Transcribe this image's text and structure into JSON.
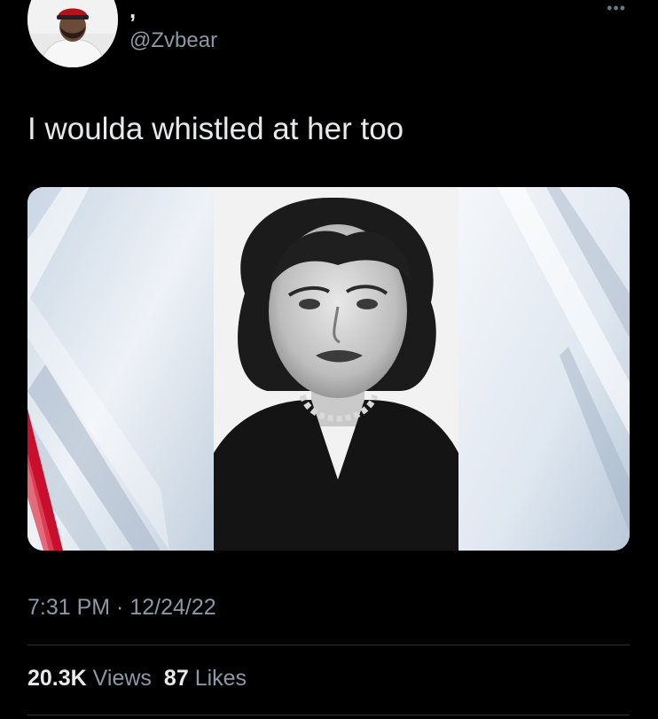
{
  "tweet": {
    "author": {
      "display_name": ",",
      "handle": "@Zvbear"
    },
    "more_icon": "more-horizontal-icon",
    "text": "I woulda whistled at her too",
    "timestamp": "7:31 PM · 12/24/22",
    "stats": {
      "views_count": "20.3K",
      "views_label": "Views",
      "likes_count": "87",
      "likes_label": "Likes"
    }
  },
  "colors": {
    "background": "#000000",
    "primary_text": "#e7e9ea",
    "secondary_text": "#8b98a5",
    "divider": "#2f3336",
    "accent_red": "#c8102e"
  }
}
